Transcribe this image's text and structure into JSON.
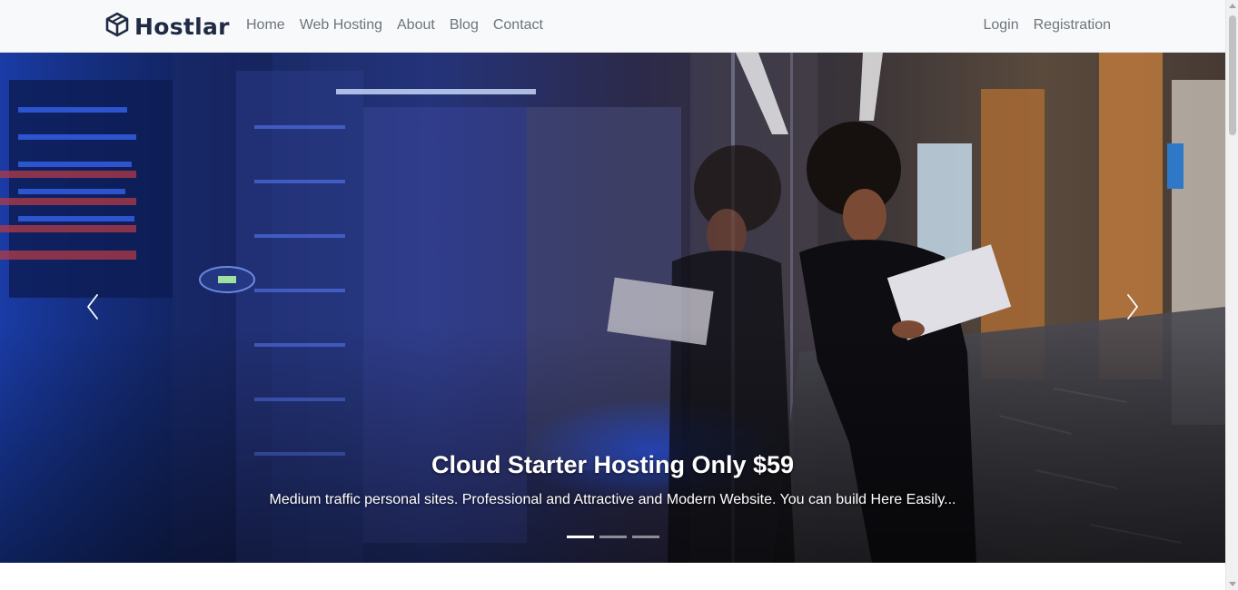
{
  "brand": {
    "name": "Hostlar",
    "icon": "cube-icon"
  },
  "nav": {
    "left": [
      "Home",
      "Web Hosting",
      "About",
      "Blog",
      "Contact"
    ],
    "right": [
      "Login",
      "Registration"
    ]
  },
  "hero": {
    "title": "Cloud Starter Hosting Only $59",
    "text": "Medium traffic personal sites. Professional and Attractive and Modern Website. You can build Here Easily...",
    "slides": 3,
    "active_slide": 1,
    "prev_icon": "chevron-left-icon",
    "next_icon": "chevron-right-icon"
  },
  "colors": {
    "brand_text": "#1f2a44",
    "nav_link": "#6c757d",
    "navbar_bg": "#f8f9fa"
  }
}
